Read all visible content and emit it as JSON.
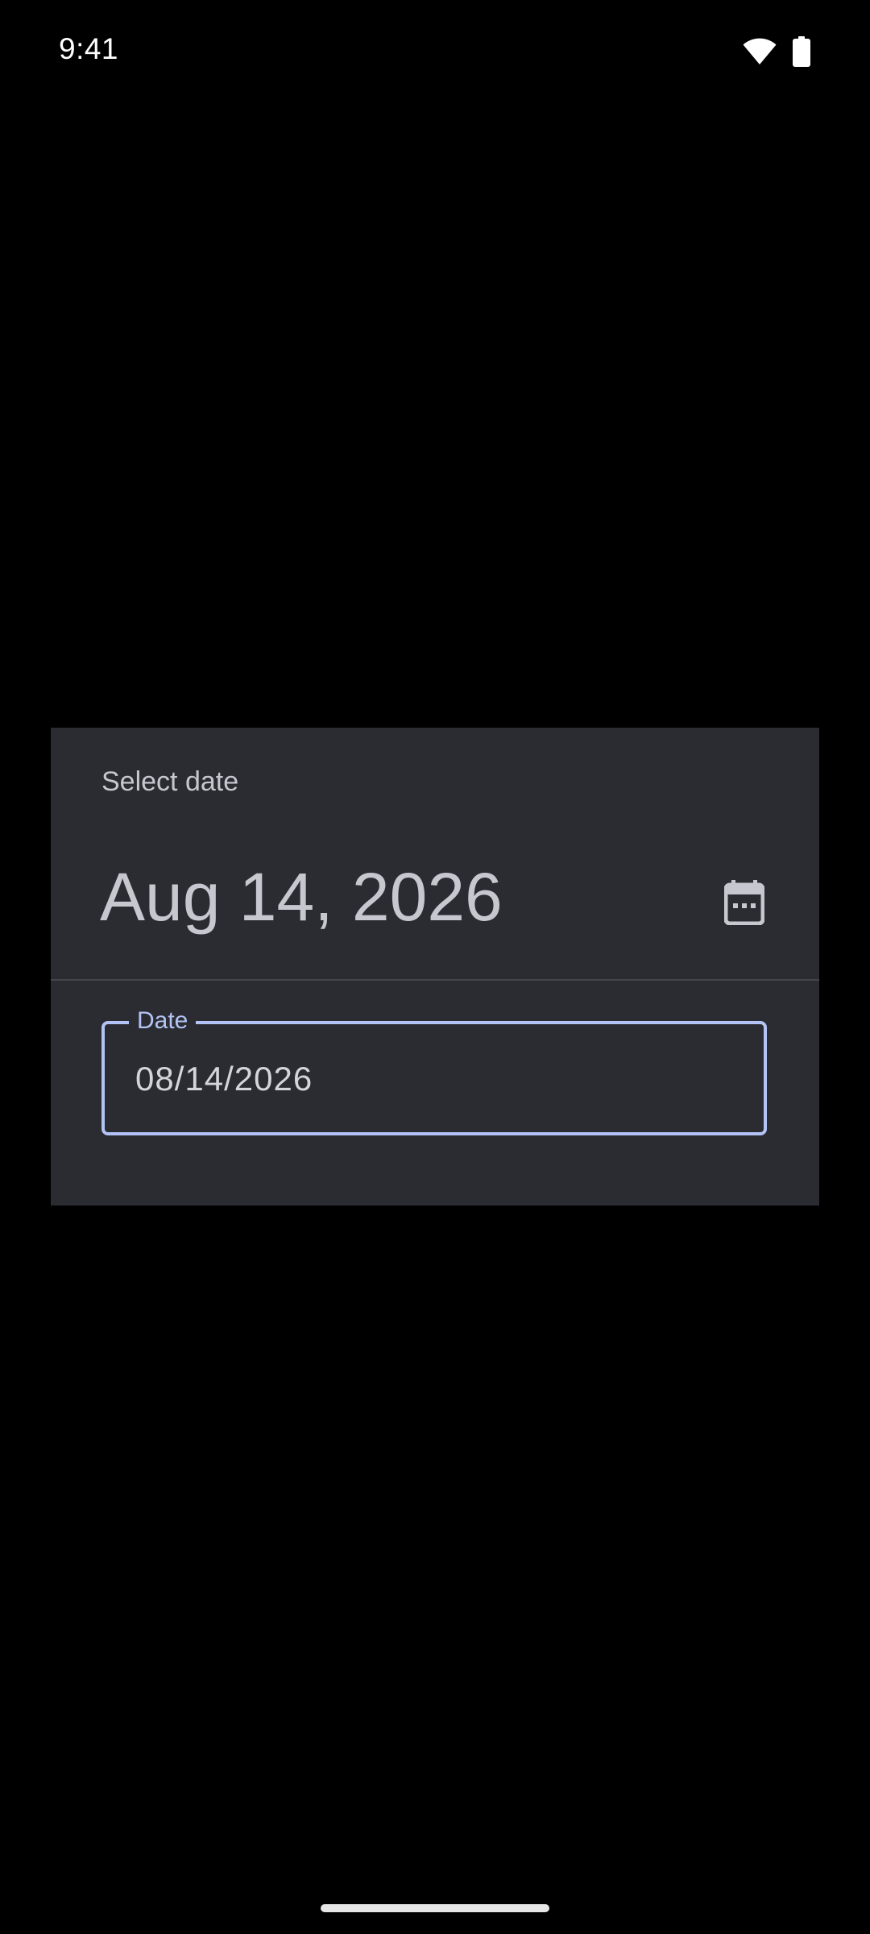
{
  "status_bar": {
    "time": "9:41",
    "icons": [
      "wifi-icon",
      "battery-icon"
    ]
  },
  "dialog": {
    "title": "Select date",
    "headline": "Aug 14, 2026",
    "mode_toggle_icon": "calendar-icon",
    "field": {
      "label": "Date",
      "value": "08/14/2026"
    }
  },
  "colors": {
    "background": "#000000",
    "dialog_surface": "#2b2c31",
    "on_surface": "#c6c7cf",
    "primary": "#b3c3f5",
    "divider": "#44464d"
  }
}
